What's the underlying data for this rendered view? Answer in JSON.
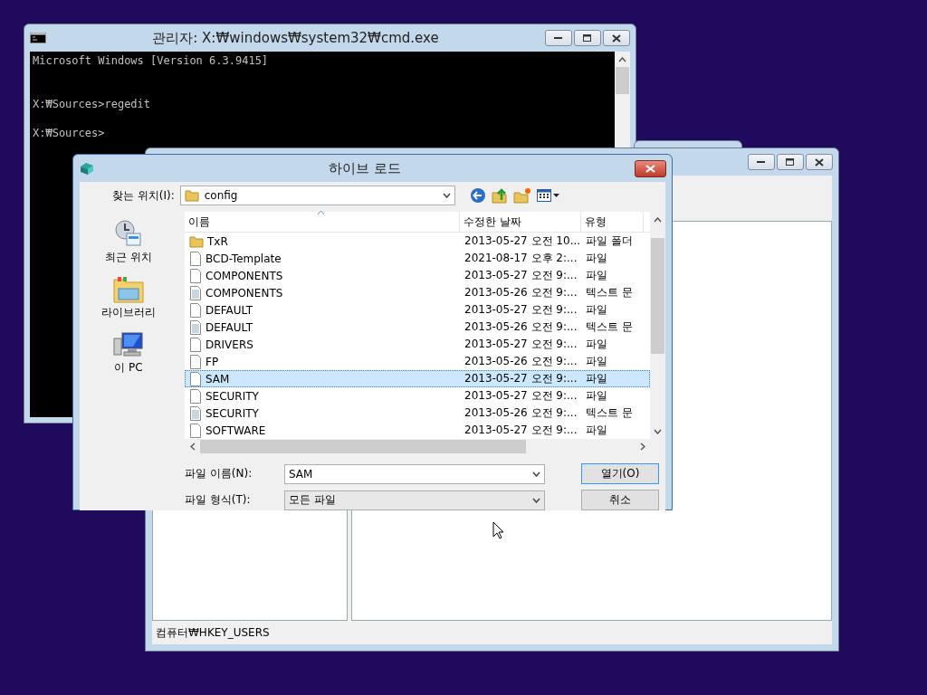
{
  "cmd_window": {
    "title": "관리자: X:₩windows₩system32₩cmd.exe",
    "console_lines": [
      "Microsoft Windows [Version 6.3.9415]",
      "X:₩Sources>regedit",
      "X:₩Sources>"
    ]
  },
  "regedit_window": {
    "status_bar": "컴퓨터₩HKEY_USERS"
  },
  "dialog": {
    "title": "하이브 로드",
    "look_in": {
      "label": "찾는 위치(I):",
      "value": "config"
    },
    "places": [
      {
        "label": "최근 위치",
        "kind": "recent"
      },
      {
        "label": "라이브러리",
        "kind": "library"
      },
      {
        "label": "이 PC",
        "kind": "pc"
      }
    ],
    "columns": [
      "이름",
      "수정한 날짜",
      "유형"
    ],
    "rows": [
      {
        "name": "TxR",
        "date": "2013-05-27 오전 10...",
        "type": "파일 폴더",
        "kind": "folder",
        "selected": false
      },
      {
        "name": "BCD-Template",
        "date": "2021-08-17 오후 2:...",
        "type": "파일",
        "kind": "file",
        "selected": false
      },
      {
        "name": "COMPONENTS",
        "date": "2013-05-27 오전 9:...",
        "type": "파일",
        "kind": "file",
        "selected": false
      },
      {
        "name": "COMPONENTS",
        "date": "2013-05-26 오전 9:...",
        "type": "텍스트 문",
        "kind": "text",
        "selected": false
      },
      {
        "name": "DEFAULT",
        "date": "2013-05-27 오전 9:...",
        "type": "파일",
        "kind": "file",
        "selected": false
      },
      {
        "name": "DEFAULT",
        "date": "2013-05-26 오전 9:...",
        "type": "텍스트 문",
        "kind": "text",
        "selected": false
      },
      {
        "name": "DRIVERS",
        "date": "2013-05-27 오전 9:...",
        "type": "파일",
        "kind": "file",
        "selected": false
      },
      {
        "name": "FP",
        "date": "2013-05-26 오전 9:...",
        "type": "파일",
        "kind": "file",
        "selected": false
      },
      {
        "name": "SAM",
        "date": "2013-05-27 오전 9:...",
        "type": "파일",
        "kind": "file",
        "selected": true
      },
      {
        "name": "SECURITY",
        "date": "2013-05-27 오전 9:...",
        "type": "파일",
        "kind": "file",
        "selected": false
      },
      {
        "name": "SECURITY",
        "date": "2013-05-26 오전 9:...",
        "type": "텍스트 문",
        "kind": "text",
        "selected": false
      },
      {
        "name": "SOFTWARE",
        "date": "2013-05-27 오전 9:...",
        "type": "파일",
        "kind": "file",
        "selected": false
      }
    ],
    "file_name": {
      "label": "파일 이름(N):",
      "value": "SAM"
    },
    "file_type": {
      "label": "파일 형식(T):",
      "value": "모든 파일"
    },
    "buttons": [
      "열기(O)",
      "취소"
    ]
  }
}
